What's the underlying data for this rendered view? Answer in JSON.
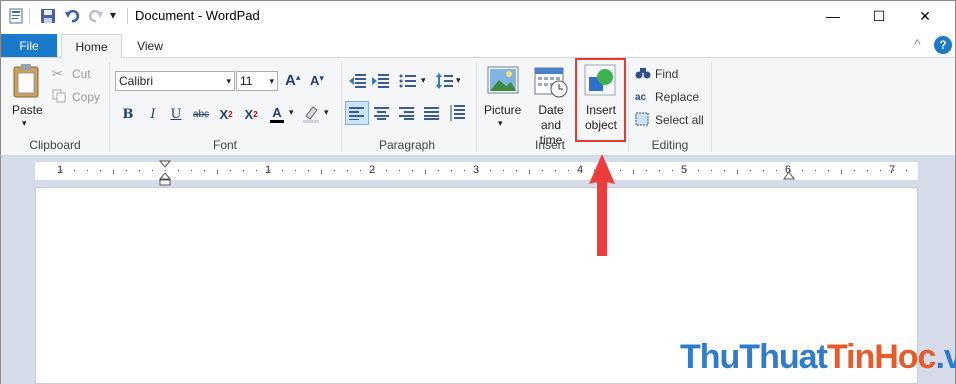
{
  "titlebar": {
    "title": "Document - WordPad",
    "qat_dropdown_glyph": "▾",
    "minimize_glyph": "—",
    "maximize_glyph": "☐",
    "close_glyph": "✕"
  },
  "tabs": {
    "file": "File",
    "home": "Home",
    "view": "View",
    "collapse_glyph": "^",
    "help_glyph": "?"
  },
  "clipboard": {
    "paste": "Paste",
    "cut": "Cut",
    "copy": "Copy",
    "label": "Clipboard"
  },
  "font": {
    "family": "Calibri",
    "size": "11",
    "grow": "A",
    "shrink": "A",
    "bold": "B",
    "italic": "I",
    "underline": "U",
    "strike": "abc",
    "subscript": "X",
    "superscript": "X",
    "color_btn": "A",
    "label": "Font"
  },
  "paragraph": {
    "label": "Paragraph"
  },
  "insert": {
    "picture": "Picture",
    "date_time_1": "Date and",
    "date_time_2": "time",
    "insert_object_1": "Insert",
    "insert_object_2": "object",
    "label": "Insert"
  },
  "editing": {
    "find": "Find",
    "replace": "Replace",
    "select_all": "Select all",
    "label": "Editing"
  },
  "ruler": {
    "numbers": [
      "1",
      "1",
      "2",
      "3",
      "4",
      "5",
      "6",
      "7"
    ]
  },
  "watermark": {
    "part1": "ThuThuat",
    "part2": "TinHoc",
    "part3": ".vn"
  },
  "colors": {
    "accent": "#1979ca",
    "highlight": "#e53935",
    "arrow": "#e53935",
    "docbg": "#d6dbe9"
  }
}
